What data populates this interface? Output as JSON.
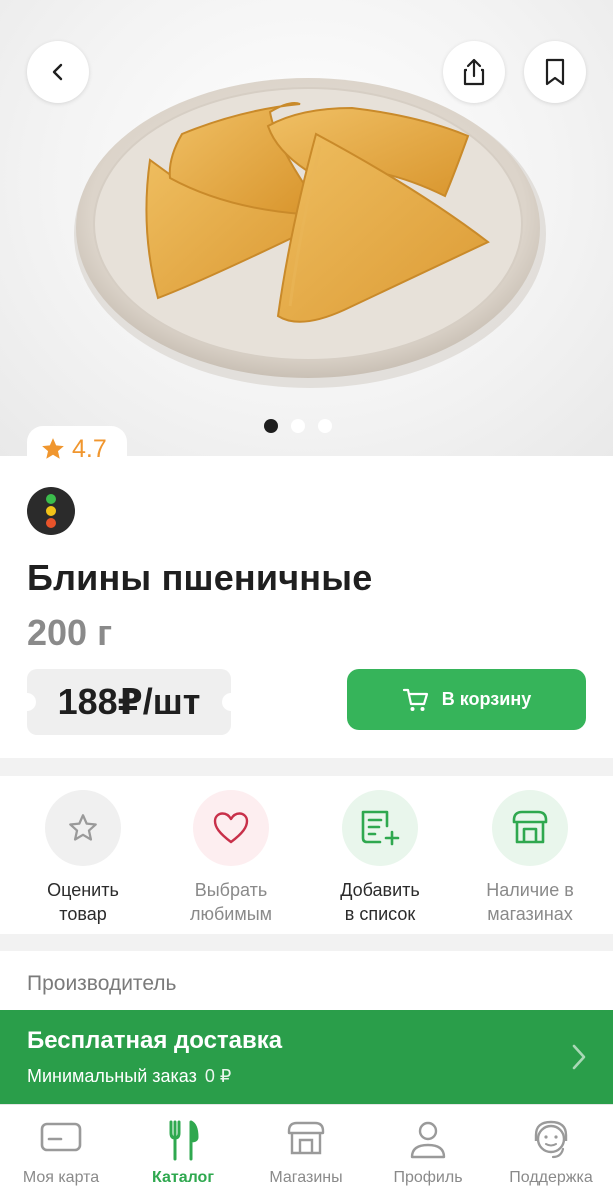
{
  "product": {
    "rating": "4.7",
    "title": "Блины пшеничные",
    "weight": "200 г",
    "price": "188₽/шт",
    "cart_button": "В корзину",
    "gallery_dots": 3,
    "gallery_active": 0
  },
  "actions": [
    {
      "line1": "Оценить",
      "line2": "товар",
      "icon": "star-outline-icon"
    },
    {
      "line1": "Выбрать",
      "line2": "любимым",
      "icon": "heart-icon"
    },
    {
      "line1": "Добавить",
      "line2": "в список",
      "icon": "add-to-list-icon"
    },
    {
      "line1": "Наличие в",
      "line2": "магазинах",
      "icon": "store-icon"
    }
  ],
  "manufacturer": {
    "label": "Производитель"
  },
  "delivery": {
    "title": "Бесплатная доставка",
    "min_label": "Минимальный заказ",
    "min_value": "0 ₽"
  },
  "nav": [
    {
      "label": "Моя карта",
      "icon": "card-icon",
      "active": false
    },
    {
      "label": "Каталог",
      "icon": "fork-knife-icon",
      "active": true
    },
    {
      "label": "Магазины",
      "icon": "store-icon",
      "active": false
    },
    {
      "label": "Профиль",
      "icon": "profile-icon",
      "active": false
    },
    {
      "label": "Поддержка",
      "icon": "support-icon",
      "active": false
    }
  ],
  "colors": {
    "accent": "#36b45a",
    "banner": "#2a9e4a",
    "rating": "#f0962e",
    "heart": "#c8304a"
  }
}
